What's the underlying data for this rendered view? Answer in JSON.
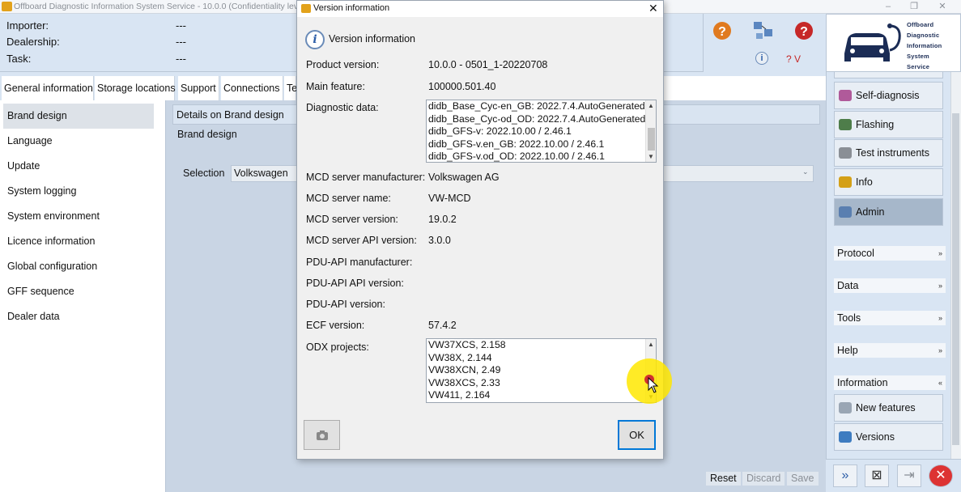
{
  "window": {
    "title": "Offboard Diagnostic Information System Service - 10.0.0 (Confidentiality level)",
    "controls": [
      "–",
      "❐",
      "✕"
    ]
  },
  "info_header": {
    "rows": [
      {
        "label": "Importer:",
        "value": "---"
      },
      {
        "label": "Dealership:",
        "value": "---"
      },
      {
        "label": "Task:",
        "value": "---"
      }
    ]
  },
  "toolbar": {
    "icons": [
      "help-red-icon",
      "network-icon",
      "help-icon",
      "info-icon"
    ],
    "version_hint": "? V"
  },
  "brand": {
    "lines": [
      "Offboard",
      "Diagnostic",
      "Information",
      "System",
      "Service"
    ]
  },
  "tabs": [
    "General information",
    "Storage locations",
    "Support",
    "Connections",
    "Te"
  ],
  "left_nav": [
    "Brand design",
    "Language",
    "Update",
    "System logging",
    "System environment",
    "Licence information",
    "Global configuration",
    "GFF sequence",
    "Dealer data"
  ],
  "content": {
    "details_header": "Details on Brand design",
    "brand_design_label": "Brand design",
    "selection_label": "Selection",
    "selection_value": "Volkswagen",
    "buttons": {
      "reset": "Reset",
      "discard": "Discard",
      "save": "Save"
    }
  },
  "right_sidebar": {
    "buttons": [
      {
        "label": "Self-diagnosis",
        "icon": "self-diagnosis-icon",
        "color": "#b05a9a"
      },
      {
        "label": "Flashing",
        "icon": "flashing-icon",
        "color": "#4e7d4a"
      },
      {
        "label": "Test instruments",
        "icon": "gauge-icon",
        "color": "#8a8f96"
      },
      {
        "label": "Info",
        "icon": "info-book-icon",
        "color": "#d4a017"
      },
      {
        "label": "Admin",
        "icon": "admin-icon",
        "color": "#5a7fb0"
      }
    ],
    "sections": [
      {
        "label": "Protocol",
        "chev": "»"
      },
      {
        "label": "Data",
        "chev": "»"
      },
      {
        "label": "Tools",
        "chev": "»"
      },
      {
        "label": "Help",
        "chev": "»"
      },
      {
        "label": "Information",
        "chev": "«"
      }
    ],
    "info_buttons": [
      {
        "label": "New features",
        "icon": "new-features-icon"
      },
      {
        "label": "Versions",
        "icon": "versions-icon"
      }
    ],
    "bottom_tools": [
      "»",
      "⊠",
      "⇥",
      "✕"
    ]
  },
  "dialog": {
    "title": "Version information",
    "close": "✕",
    "heading": "Version information",
    "fields": [
      {
        "label": "Product version:",
        "value": "10.0.0  -  0501_1-20220708"
      },
      {
        "label": "Main feature:",
        "value": "100000.501.40"
      },
      {
        "label": "Diagnostic data:",
        "value": ""
      },
      {
        "label": "MCD server manufacturer:",
        "value": "Volkswagen AG"
      },
      {
        "label": "MCD server name:",
        "value": "VW-MCD"
      },
      {
        "label": "MCD server version:",
        "value": "19.0.2"
      },
      {
        "label": "MCD server API version:",
        "value": "3.0.0"
      },
      {
        "label": "PDU-API manufacturer:",
        "value": ""
      },
      {
        "label": "PDU-API API version:",
        "value": ""
      },
      {
        "label": "PDU-API version:",
        "value": ""
      },
      {
        "label": "ECF version:",
        "value": "57.4.2"
      },
      {
        "label": "ODX projects:",
        "value": ""
      }
    ],
    "diagnostic_data": [
      "didb_Base_Cyc-en_GB: 2022.7.4.AutoGenerated",
      "didb_Base_Cyc-od_OD: 2022.7.4.AutoGenerated",
      "didb_GFS-v: 2022.10.00 / 2.46.1",
      "didb_GFS-v.en_GB: 2022.10.00 / 2.46.1",
      "didb_GFS-v.od_OD: 2022.10.00 / 2.46.1"
    ],
    "odx_projects": [
      "VW37XCS, 2.158",
      "VW38X, 2.144",
      "VW38XCN, 2.49",
      "VW38XCS, 2.33",
      "VW411, 2.164"
    ],
    "ok_label": "OK",
    "camera_icon": "📷"
  }
}
